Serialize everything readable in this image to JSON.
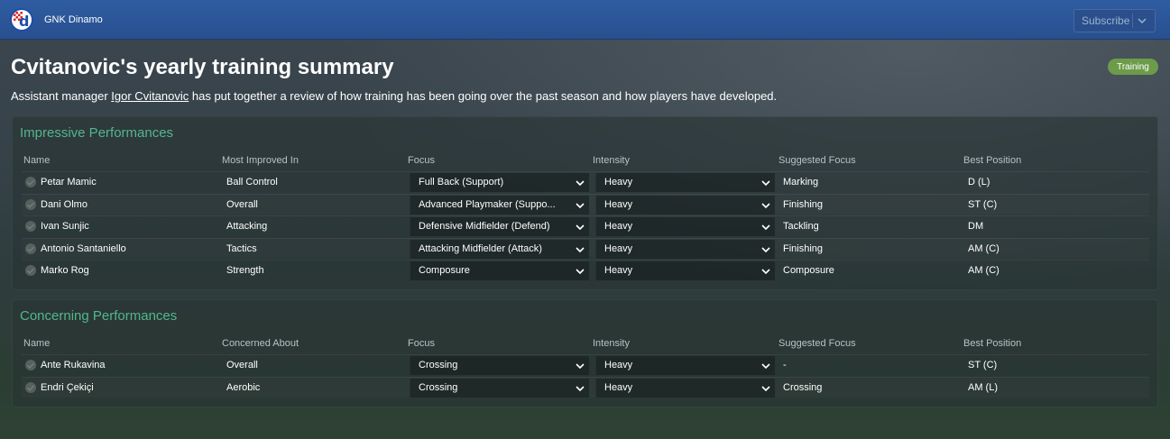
{
  "club": {
    "name": "GNK Dinamo",
    "crest_letter": "d"
  },
  "header": {
    "subscribe_label": "Subscribe"
  },
  "page": {
    "title": "Cvitanovic's yearly training summary",
    "badge": "Training",
    "intro_prefix": "Assistant manager ",
    "intro_link": "Igor Cvitanovic",
    "intro_suffix": " has put together a review of how training has been going over the past season and how players have developed."
  },
  "impressive": {
    "title": "Impressive Performances",
    "columns": [
      "Name",
      "Most Improved In",
      "Focus",
      "Intensity",
      "Suggested Focus",
      "Best Position"
    ],
    "rows": [
      {
        "name": "Petar Mamic",
        "area": "Ball Control",
        "focus": "Full Back (Support)",
        "intensity": "Heavy",
        "suggested": "Marking",
        "position": "D (L)"
      },
      {
        "name": "Dani Olmo",
        "area": "Overall",
        "focus": "Advanced Playmaker (Suppo...",
        "intensity": "Heavy",
        "suggested": "Finishing",
        "position": "ST (C)"
      },
      {
        "name": "Ivan Sunjic",
        "area": "Attacking",
        "focus": "Defensive Midfielder (Defend)",
        "intensity": "Heavy",
        "suggested": "Tackling",
        "position": "DM"
      },
      {
        "name": "Antonio Santaniello",
        "area": "Tactics",
        "focus": "Attacking Midfielder (Attack)",
        "intensity": "Heavy",
        "suggested": "Finishing",
        "position": "AM (C)"
      },
      {
        "name": "Marko Rog",
        "area": "Strength",
        "focus": "Composure",
        "intensity": "Heavy",
        "suggested": "Composure",
        "position": "AM (C)"
      }
    ]
  },
  "concerning": {
    "title": "Concerning Performances",
    "columns": [
      "Name",
      "Concerned About",
      "Focus",
      "Intensity",
      "Suggested Focus",
      "Best Position"
    ],
    "rows": [
      {
        "name": "Ante Rukavina",
        "area": "Overall",
        "focus": "Crossing",
        "intensity": "Heavy",
        "suggested": "-",
        "position": "ST (C)"
      },
      {
        "name": "Endri Çekiçi",
        "area": "Aerobic",
        "focus": "Crossing",
        "intensity": "Heavy",
        "suggested": "Crossing",
        "position": "AM (L)"
      }
    ]
  },
  "colors": {
    "accent": "#52b78c",
    "badge": "#6c9c4a",
    "topbar": "#2f5ca2"
  }
}
